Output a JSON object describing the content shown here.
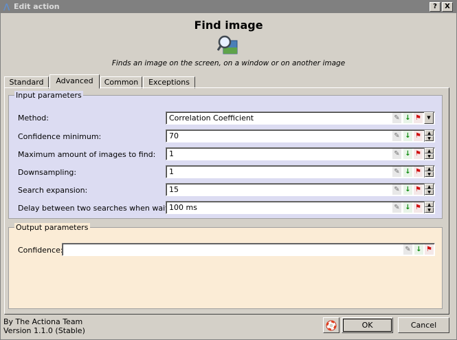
{
  "window": {
    "title": "Edit action",
    "help_label": "?",
    "close_label": "X"
  },
  "header": {
    "title": "Find image",
    "icon": "magnifier-on-image-icon",
    "description": "Finds an image on the screen, on a window or on another image"
  },
  "tabs": [
    {
      "label": "Standard"
    },
    {
      "label": "Advanced"
    },
    {
      "label": "Common"
    },
    {
      "label": "Exceptions"
    }
  ],
  "active_tab": "Advanced",
  "input_parameters": {
    "title": "Input parameters",
    "rows": [
      {
        "label": "Method:",
        "value": "Correlation Coefficient",
        "control": "dropdown"
      },
      {
        "label": "Confidence minimum:",
        "value": "70",
        "control": "spinbox"
      },
      {
        "label": "Maximum amount of images to find:",
        "value": "1",
        "control": "spinbox"
      },
      {
        "label": "Downsampling:",
        "value": "1",
        "control": "spinbox"
      },
      {
        "label": "Search expansion:",
        "value": "15",
        "control": "spinbox"
      },
      {
        "label": "Delay between two searches when waiting:",
        "value": "100 ms",
        "control": "spinbox"
      }
    ]
  },
  "output_parameters": {
    "title": "Output parameters",
    "rows": [
      {
        "label": "Confidence:",
        "value": ""
      }
    ]
  },
  "footer": {
    "credit": "By The Actiona Team",
    "version": "Version 1.1.0 (Stable)",
    "help_icon": "lifebuoy-icon",
    "ok_label": "OK",
    "cancel_label": "Cancel"
  },
  "colors": {
    "input_group_bg": "#dcdcf2",
    "output_group_bg": "#fbecd6",
    "titlebar_bg": "#808080",
    "variable_icon": "#0d8a0d",
    "flag_icon": "#d01010"
  }
}
